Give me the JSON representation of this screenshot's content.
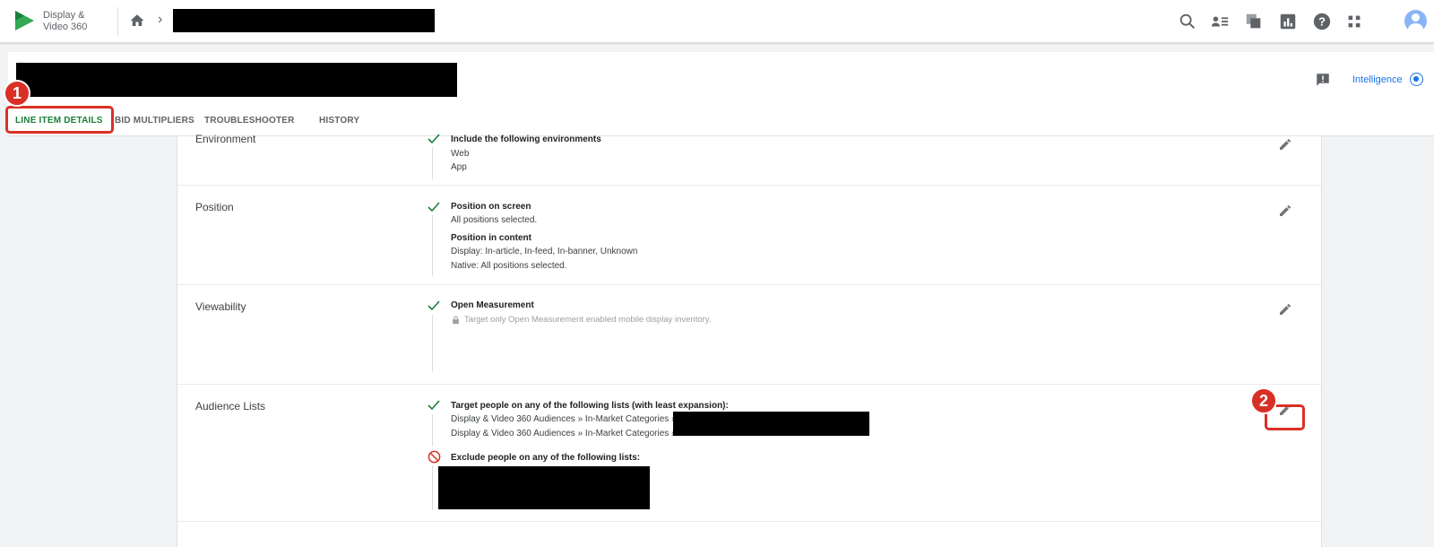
{
  "app": {
    "brand_line1": "Display &",
    "brand_line2": "Video 360"
  },
  "header": {
    "intelligence_label": "Intelligence"
  },
  "tabs": [
    {
      "label": "LINE ITEM DETAILS",
      "active": true
    },
    {
      "label": "BID MULTIPLIERS",
      "active": false
    },
    {
      "label": "TROUBLESHOOTER",
      "active": false
    },
    {
      "label": "HISTORY",
      "active": false
    }
  ],
  "callouts": {
    "one": "1",
    "two": "2"
  },
  "sections": {
    "environment": {
      "title": "Environment",
      "heading": "Include the following environments",
      "items": [
        "Web",
        "App"
      ]
    },
    "position": {
      "title": "Position",
      "heading1": "Position on screen",
      "value1": "All positions selected.",
      "heading2": "Position in content",
      "value2a": "Display: In-article, In-feed, In-banner, Unknown",
      "value2b": "Native: All positions selected."
    },
    "viewability": {
      "title": "Viewability",
      "heading": "Open Measurement",
      "note": "Target only Open Measurement enabled mobile display inventory."
    },
    "audience": {
      "title": "Audience Lists",
      "include_heading": "Target people on any of the following lists (with least expansion):",
      "include_items": [
        "Display & Video 360 Audiences » In-Market Categories »",
        "Display & Video 360 Audiences » In-Market Categories »"
      ],
      "exclude_heading": "Exclude people on any of the following lists:"
    }
  },
  "colors": {
    "accent_green": "#188038",
    "link_blue": "#1a73e8",
    "callout_red": "#d93025"
  }
}
